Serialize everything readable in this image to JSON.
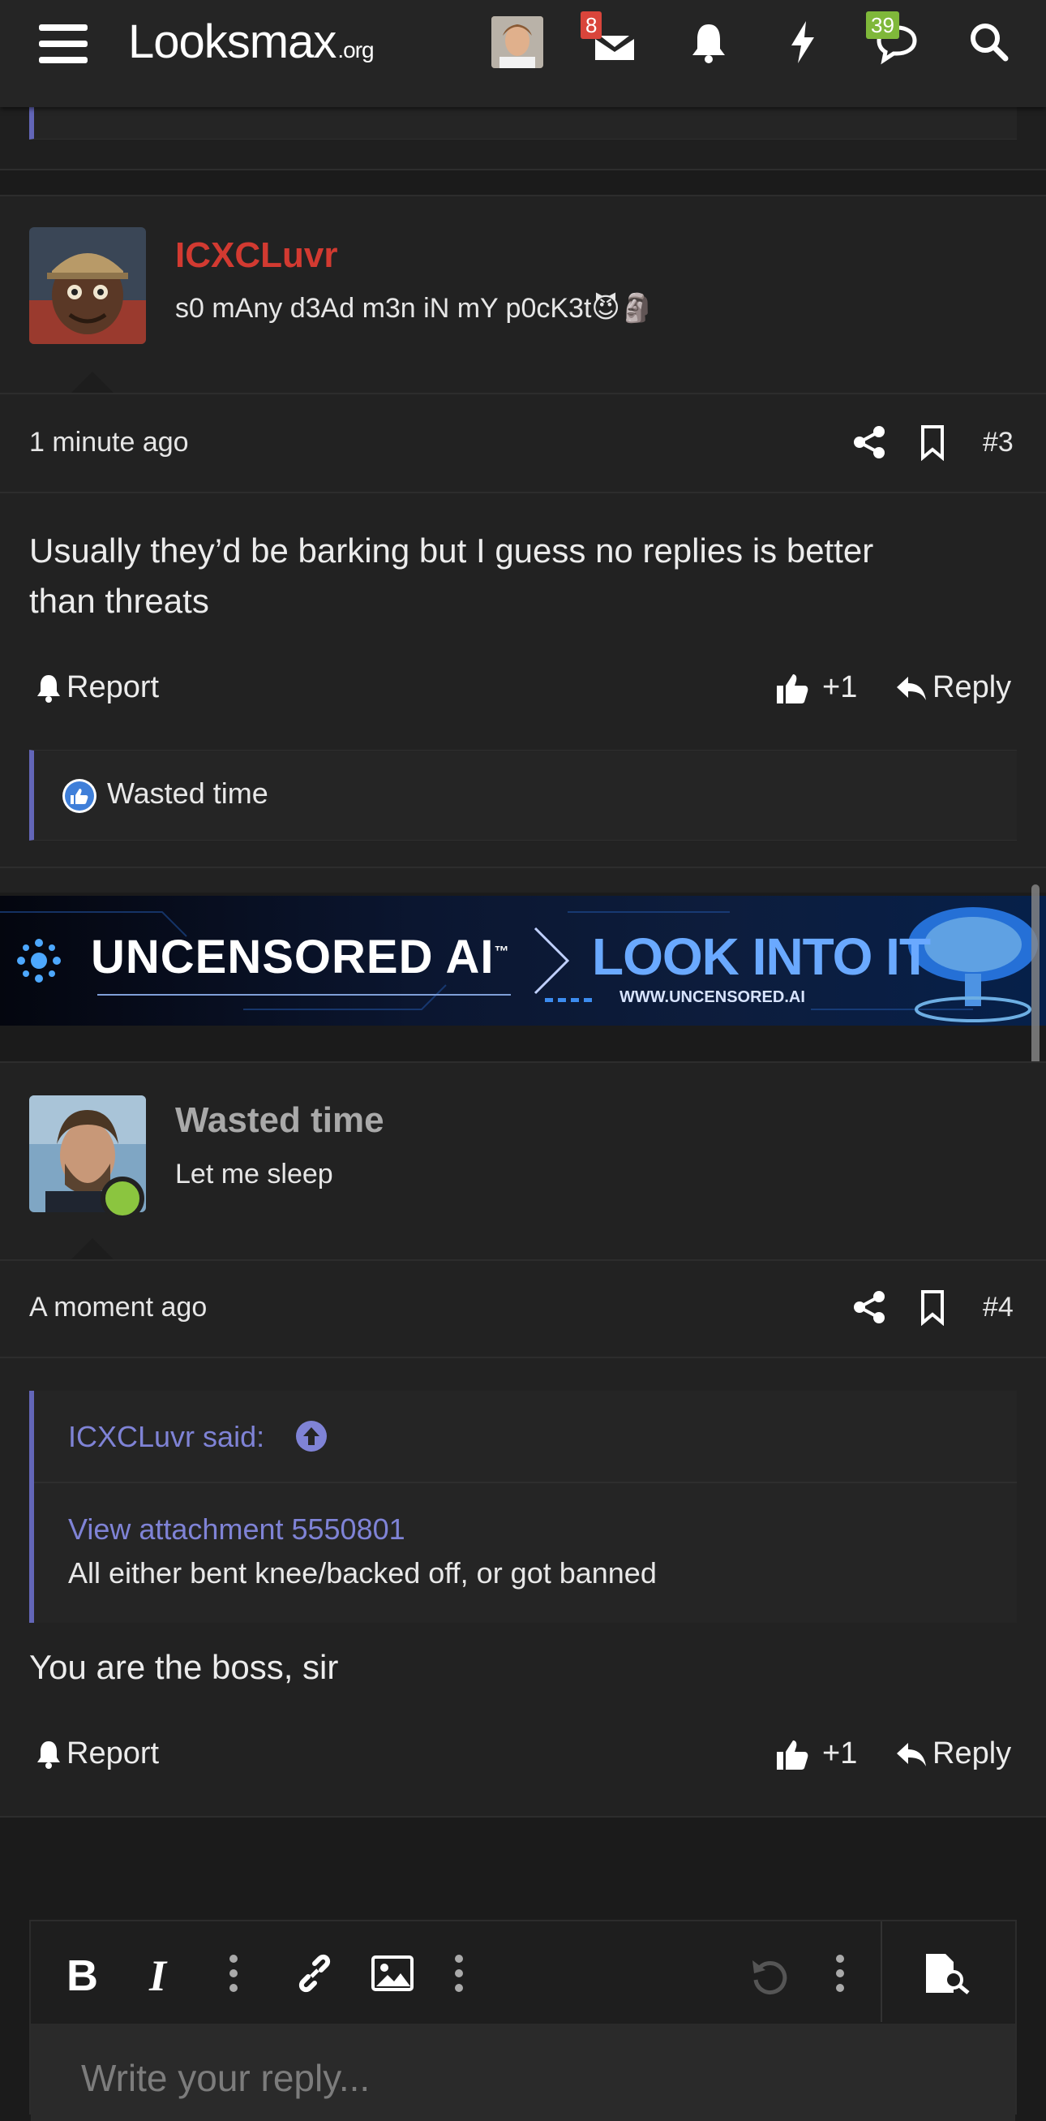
{
  "header": {
    "logo_main": "Looksmax",
    "logo_suffix": ".org",
    "inbox_badge": "8",
    "conversations_badge": "39"
  },
  "posts": [
    {
      "username": "ICXCLuvr",
      "username_color": "#d23a31",
      "user_title": "s0 mAny d3Ad m3n iN mY p0cK3t😈🗿",
      "time": "1 minute ago",
      "post_number": "#3",
      "body_lines": [
        "Usually they’d be barking but I guess no replies is better",
        "than threats"
      ],
      "report_label": "Report",
      "like_count": "+1",
      "reply_label": "Reply",
      "reaction_user": "Wasted time"
    },
    {
      "username": "Wasted time",
      "username_color": "#a9a9a9",
      "user_title": "Let me sleep",
      "time": "A moment ago",
      "post_number": "#4",
      "quote_author": "ICXCLuvr said:",
      "quote_attachment": "View attachment 5550801",
      "quote_text": "All either bent knee/backed off, or got banned",
      "body": "You are the boss, sir",
      "report_label": "Report",
      "like_count": "+1",
      "reply_label": "Reply"
    }
  ],
  "ad": {
    "left_text": "UNCENSORED AI",
    "trademark": "™",
    "right_text": "LOOK INTO IT",
    "url": "WWW.UNCENSORED.AI"
  },
  "editor": {
    "placeholder": "Write your reply..."
  }
}
